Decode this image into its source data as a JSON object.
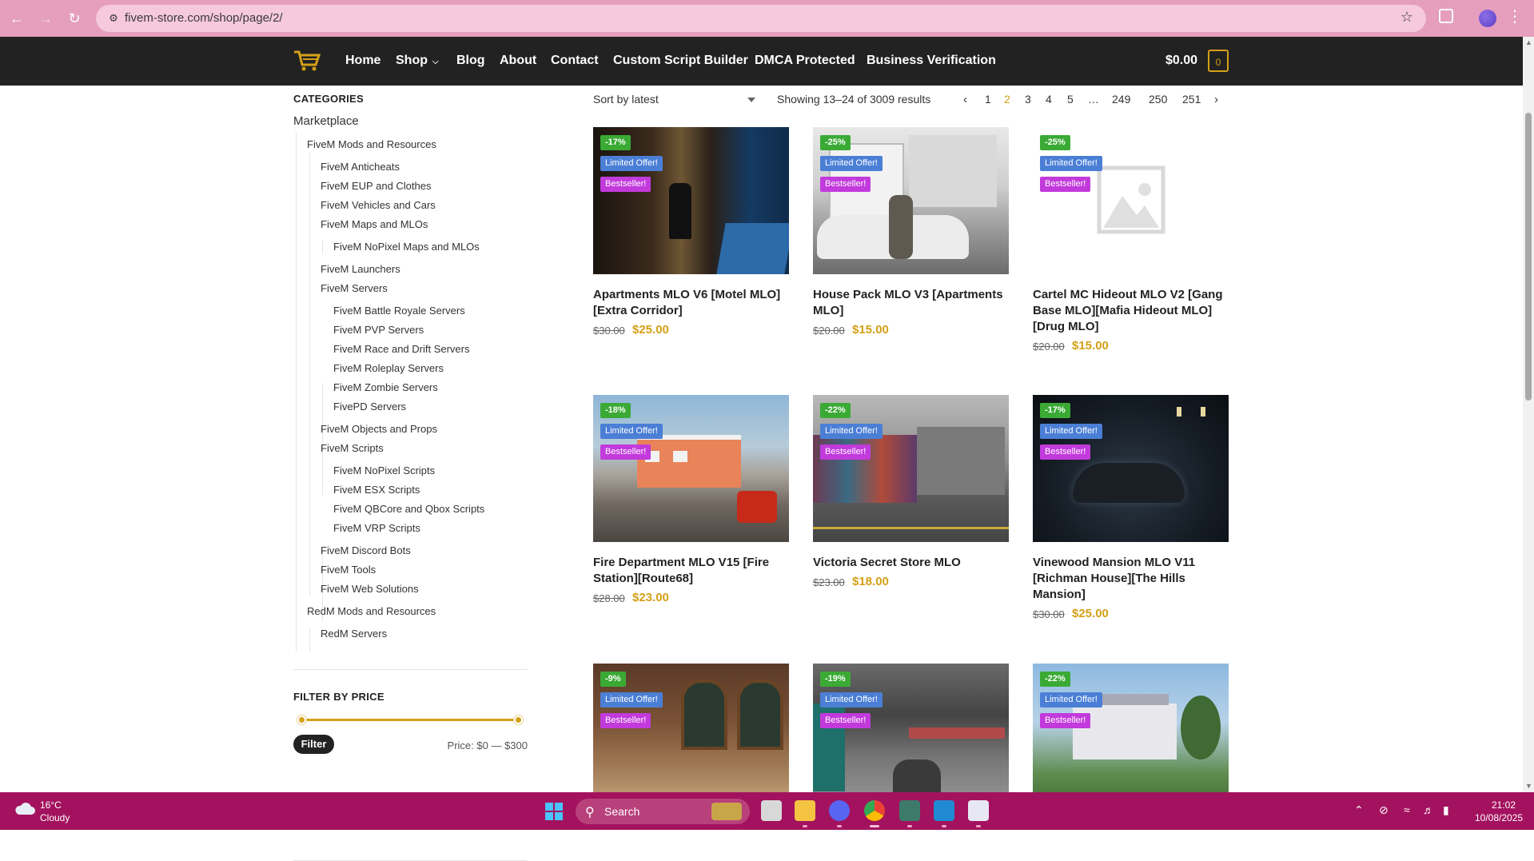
{
  "browser": {
    "url": "fivem-store.com/shop/page/2/"
  },
  "nav": {
    "home": "Home",
    "shop": "Shop",
    "blog": "Blog",
    "about": "About",
    "contact": "Contact",
    "script_builder": "Custom Script Builder",
    "dmca": "DMCA Protected",
    "verification": "Business Verification",
    "cart_total": "$0.00",
    "cart_count": "0"
  },
  "sidebar": {
    "categories_title": "CATEGORIES",
    "marketplace": "Marketplace",
    "c_fivem_mods": "FiveM Mods and Resources",
    "c_anticheats": "FiveM Anticheats",
    "c_eup": "FiveM EUP and Clothes",
    "c_vehicles": "FiveM Vehicles and Cars",
    "c_maps": "FiveM Maps and MLOs",
    "c_nopixel_maps": "FiveM NoPixel Maps and MLOs",
    "c_launchers": "FiveM Launchers",
    "c_servers": "FiveM Servers",
    "c_battle": "FiveM Battle Royale Servers",
    "c_pvp": "FiveM PVP Servers",
    "c_race": "FiveM Race and Drift Servers",
    "c_roleplay": "FiveM Roleplay Servers",
    "c_zombie": "FiveM Zombie Servers",
    "c_fivepd": "FivePD Servers",
    "c_objects": "FiveM Objects and Props",
    "c_scripts": "FiveM Scripts",
    "c_nopixel_scripts": "FiveM NoPixel Scripts",
    "c_esx": "FiveM ESX Scripts",
    "c_qbcore": "FiveM QBCore and Qbox Scripts",
    "c_vrp": "FiveM VRP Scripts",
    "c_discord": "FiveM Discord Bots",
    "c_tools": "FiveM Tools",
    "c_web": "FiveM Web Solutions",
    "c_redm": "RedM Mods and Resources",
    "c_redm_servers": "RedM Servers",
    "filter_title": "FILTER BY PRICE",
    "filter_button": "Filter",
    "price_range": "Price: $0 — $300",
    "price_min_fraction": 0,
    "price_max_fraction": 1
  },
  "toolbar": {
    "sort": "Sort by latest",
    "results": "Showing 13–24 of 3009 results",
    "pages": [
      "1",
      "2",
      "3",
      "4",
      "5",
      "…",
      "249",
      "250",
      "251"
    ],
    "current_page": "2"
  },
  "products": [
    {
      "sale": "-17%",
      "limited": "Limited Offer!",
      "best": "Bestseller!",
      "title": "Apartments MLO V6 [Motel MLO] [Extra Corridor]",
      "old": "$30.00",
      "price": "$25.00"
    },
    {
      "sale": "-25%",
      "limited": "Limited Offer!",
      "best": "Bestseller!",
      "title": "House Pack MLO V3 [Apartments MLO]",
      "old": "$20.00",
      "price": "$15.00"
    },
    {
      "sale": "-25%",
      "limited": "Limited Offer!",
      "best": "Bestseller!",
      "title": "Cartel MC Hideout MLO V2 [Gang Base MLO][Mafia Hideout MLO][Drug MLO]",
      "old": "$20.00",
      "price": "$15.00"
    },
    {
      "sale": "-18%",
      "limited": "Limited Offer!",
      "best": "Bestseller!",
      "title": "Fire Department MLO V15 [Fire Station][Route68]",
      "old": "$28.00",
      "price": "$23.00"
    },
    {
      "sale": "-22%",
      "limited": "Limited Offer!",
      "best": "Bestseller!",
      "title": "Victoria Secret Store MLO",
      "old": "$23.00",
      "price": "$18.00"
    },
    {
      "sale": "-17%",
      "limited": "Limited Offer!",
      "best": "Bestseller!",
      "title": "Vinewood Mansion MLO V11 [Richman House][The Hills Mansion]",
      "old": "$30.00",
      "price": "$25.00"
    },
    {
      "sale": "-9%",
      "limited": "Limited Offer!",
      "best": "Bestseller!"
    },
    {
      "sale": "-19%",
      "limited": "Limited Offer!",
      "best": "Bestseller!"
    },
    {
      "sale": "-22%",
      "limited": "Limited Offer!",
      "best": "Bestseller!"
    }
  ],
  "taskbar": {
    "temp": "16°C",
    "weather": "Cloudy",
    "search": "Search",
    "time": "21:02",
    "date": "10/08/2025"
  },
  "colors": {
    "accent": "#d4a017",
    "header": "#222222",
    "taskbar": "#a3125e",
    "chrome": "#e59ebd"
  }
}
